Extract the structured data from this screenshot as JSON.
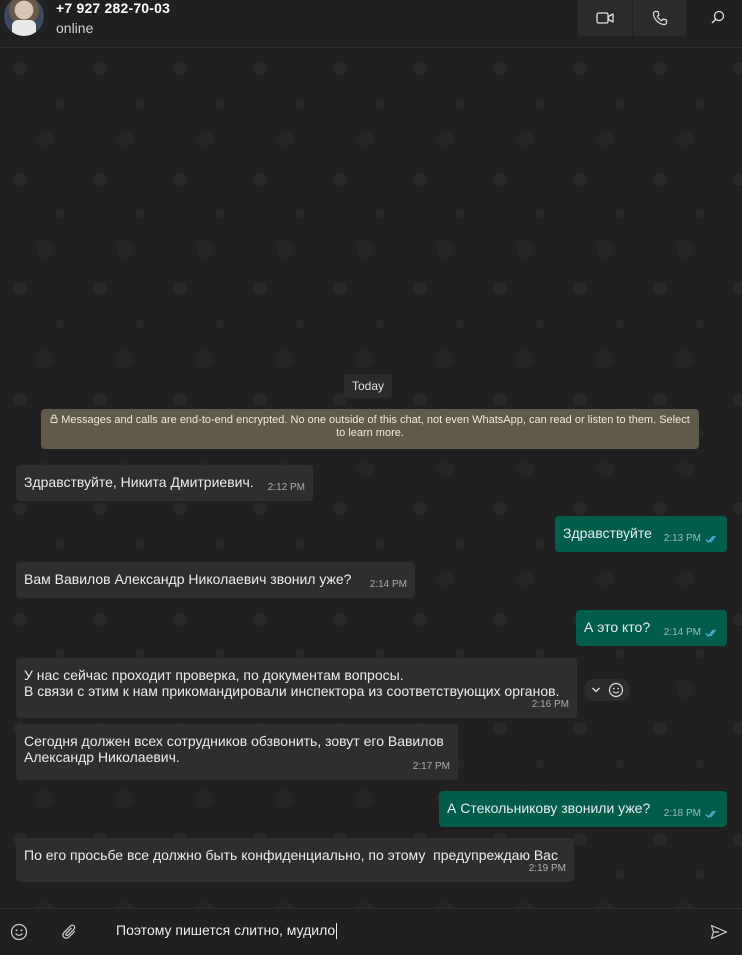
{
  "header": {
    "contact_name": "+7 927 282-70-03",
    "status": "online",
    "icons": [
      "avatar",
      "video-call-icon",
      "voice-call-icon",
      "search-icon"
    ]
  },
  "chat": {
    "date_chip": "Today",
    "encryption_notice": "Messages and calls are end-to-end encrypted. No one outside of this chat, not even WhatsApp, can read or listen to them. Select to learn more.",
    "messages": [
      {
        "direction": "in",
        "text": "Здравствуйте, Никита Дмитриевич.",
        "time": "2:12 PM"
      },
      {
        "direction": "out",
        "text": "Здравствуйте",
        "time": "2:13 PM",
        "status": "read"
      },
      {
        "direction": "in",
        "text": "Вам Вавилов Александр Николаевич звонил уже?",
        "time": "2:14 PM"
      },
      {
        "direction": "out",
        "text": "А это кто?",
        "time": "2:14 PM",
        "status": "read"
      },
      {
        "direction": "in",
        "text": "У нас сейчас проходит проверка, по документам вопросы.\nВ связи с этим к нам прикомандировали инспектора из соответствующих органов.",
        "time": "2:16 PM"
      },
      {
        "direction": "in",
        "text": "Сегодня должен всех сотрудников обзвонить, зовут его Вавилов\nАлександр Николаевич.",
        "time": "2:17 PM"
      },
      {
        "direction": "out",
        "text": "А Стекольникову звонили уже?",
        "time": "2:18 PM",
        "status": "read"
      },
      {
        "direction": "in",
        "text": "По его просьбе все должно быть конфиденциально, по этому  предупреждаю Вас",
        "time": "2:19 PM"
      }
    ]
  },
  "composer": {
    "text": "Поэтому пишется слитно, мудило",
    "icons": [
      "emoji-icon",
      "attach-icon",
      "send-icon"
    ]
  },
  "colors": {
    "incoming_bubble": "#2e2e2e",
    "outgoing_bubble": "#005c4b",
    "read_ticks": "#53bdeb",
    "notice_bg": "#5f5a49"
  }
}
